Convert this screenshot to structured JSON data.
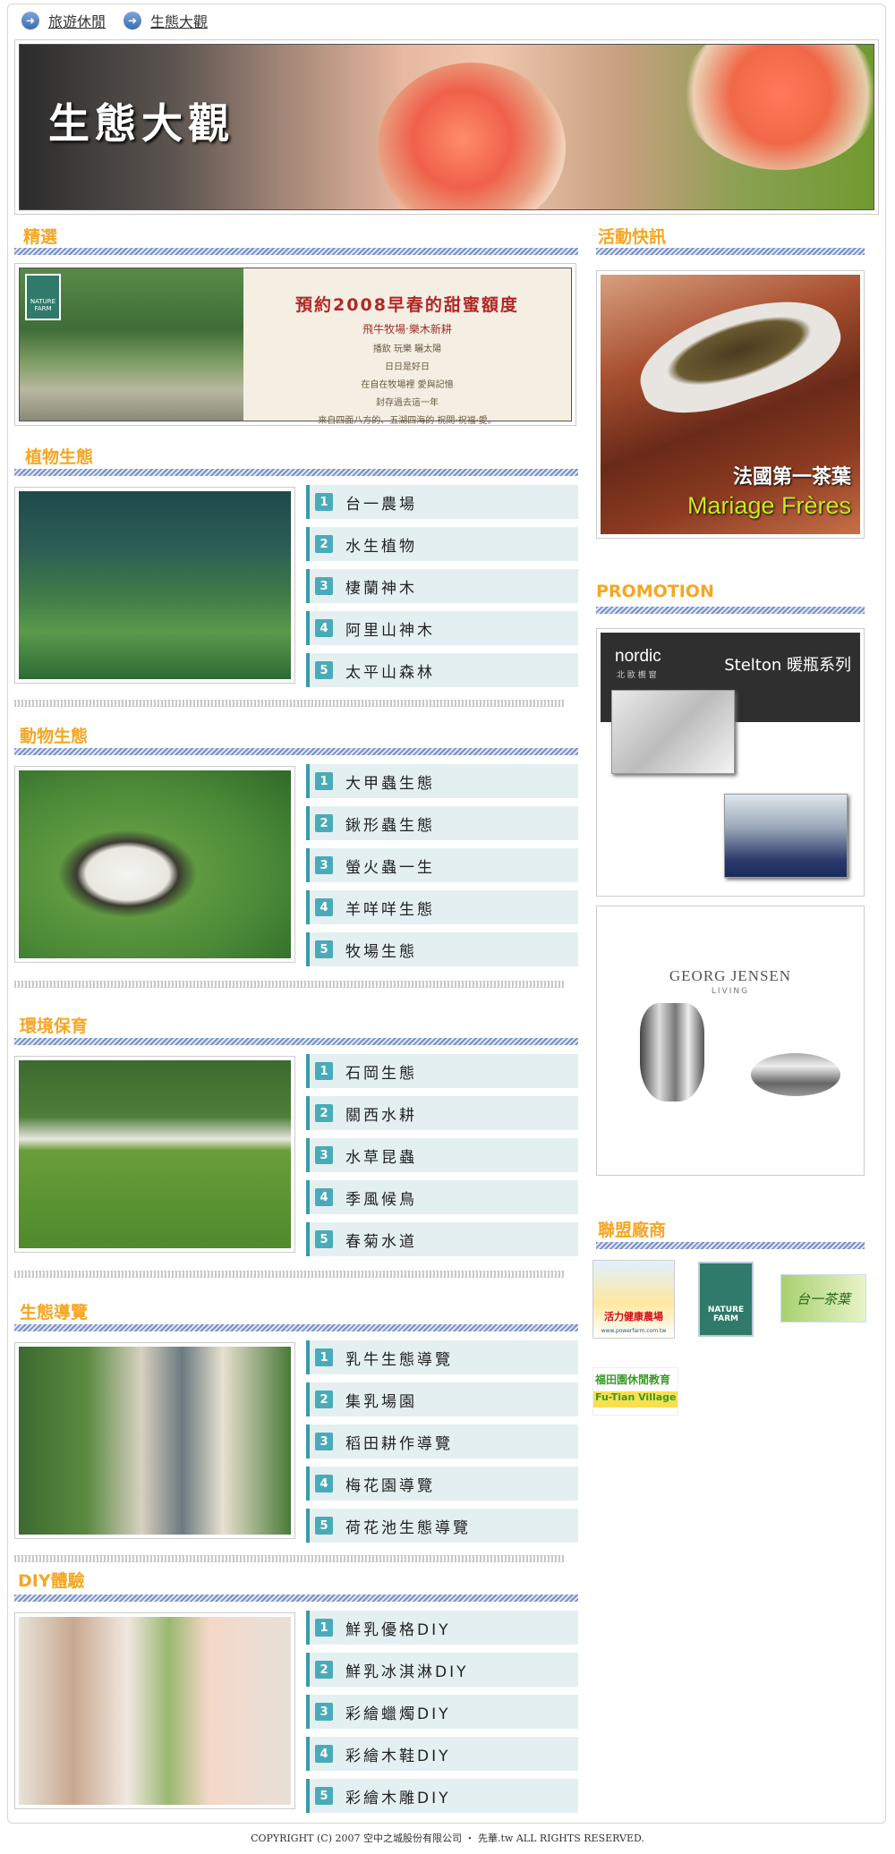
{
  "breadcrumb": {
    "items": [
      "旅遊休閒",
      "生態大觀"
    ]
  },
  "banner": {
    "title": "生態大觀"
  },
  "sections": {
    "featured": "精選",
    "plants": "植物生態",
    "animals": "動物生態",
    "environment": "環境保育",
    "tour": "生態導覽",
    "diy": "DIY體驗",
    "news": "活動快訊",
    "promotion": "PROMOTION",
    "partners": "聯盟廠商"
  },
  "featured_card": {
    "logo": "NATURE FARM",
    "title": "預約2008早春的甜蜜額度",
    "subtitle": "飛牛牧場‧樂木新耕",
    "lines": [
      "播飲 玩樂 曬太陽",
      "日日是好日",
      "在自在牧場裡 愛與記憶",
      "封存過去這一年",
      "來自四面八方的、五湖四海的 祝問‧祝福‧愛。"
    ]
  },
  "lists": {
    "plants": [
      "台一農場",
      "水生植物",
      "棲蘭神木",
      "阿里山神木",
      "太平山森林"
    ],
    "animals": [
      "大甲蟲生態",
      "鍬形蟲生態",
      "螢火蟲一生",
      "羊咩咩生態",
      "牧場生態"
    ],
    "environment": [
      "石岡生態",
      "關西水耕",
      "水草昆蟲",
      "季風候鳥",
      "春菊水道"
    ],
    "tour": [
      "乳牛生態導覽",
      "集乳場園",
      "稻田耕作導覽",
      "梅花園導覽",
      "荷花池生態導覽"
    ],
    "diy": [
      "鮮乳優格DIY",
      "鮮乳冰淇淋DIY",
      "彩繪蠟燭DIY",
      "彩繪木鞋DIY",
      "彩繪木雕DIY"
    ]
  },
  "numbers": [
    "1",
    "2",
    "3",
    "4",
    "5"
  ],
  "news_ad": {
    "line1": "法國第一茶葉",
    "line2": "Mariage Frères"
  },
  "promo_ad": {
    "brand": "nordic",
    "brand_sub": "北 歐 櫥 窗",
    "product": "Stelton 暖瓶系列"
  },
  "jensen_ad": {
    "brand": "GEORG JENSEN",
    "sub": "LIVING"
  },
  "partners": [
    {
      "label": "活力健康農場",
      "sub": "www.powerfarm.com.tw"
    },
    {
      "label": "NATURE FARM"
    },
    {
      "label": "台一茶葉"
    },
    {
      "label": "福田園休閒教育",
      "sub": "Fu-Tian Village"
    }
  ],
  "footer": "COPYRIGHT (C) 2007 空中之城股份有限公司 ‧ 先華.tw ALL RIGHTS RESERVED.",
  "colors": {
    "accent": "#f5a623",
    "list_bg": "#e4eff2",
    "list_number": "#4aabb8"
  }
}
